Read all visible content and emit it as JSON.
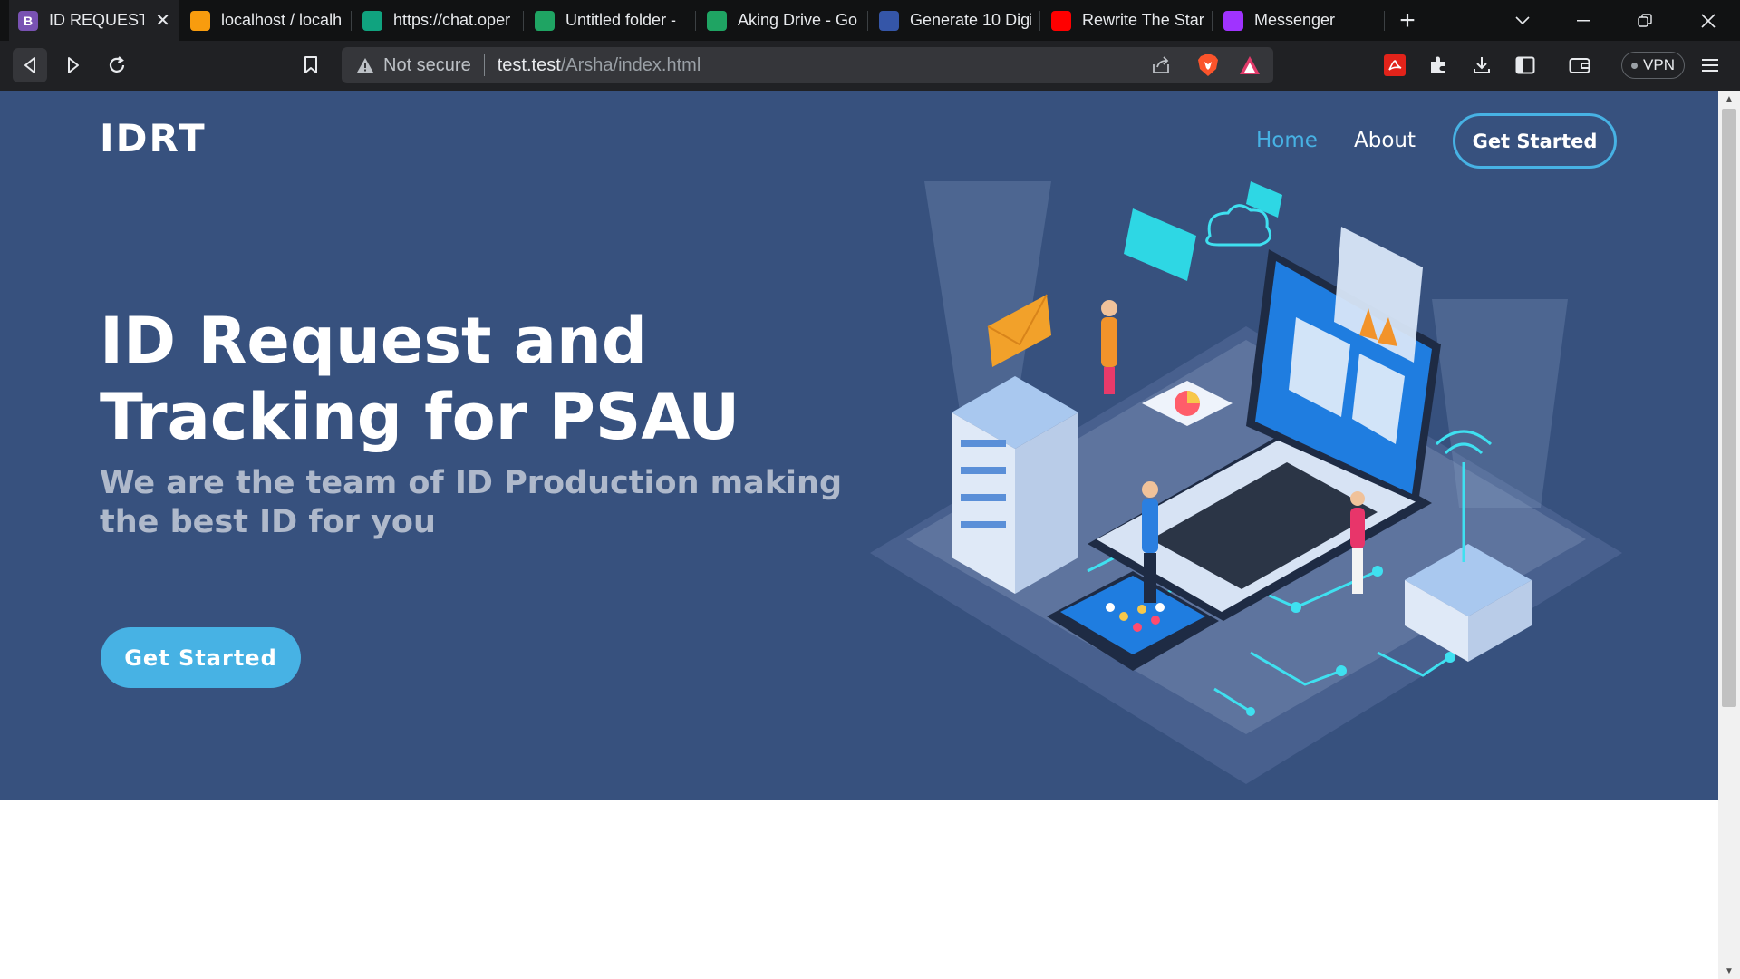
{
  "browser": {
    "tabs": [
      {
        "title": "ID REQUEST",
        "favicon": "B",
        "favicon_color": "#7952b3",
        "active": true
      },
      {
        "title": "localhost / localh",
        "favicon": "pma",
        "favicon_color": "#f89c0e"
      },
      {
        "title": "https://chat.oper",
        "favicon": "gpt",
        "favicon_color": "#10a37f"
      },
      {
        "title": "Untitled folder -",
        "favicon": "drive",
        "favicon_color": "#1fa463"
      },
      {
        "title": "Aking Drive - Go",
        "favicon": "drive",
        "favicon_color": "#1fa463"
      },
      {
        "title": "Generate 10 Digi",
        "favicon": "gen",
        "favicon_color": "#3556a8"
      },
      {
        "title": "Rewrite The Stars",
        "favicon": "yt",
        "favicon_color": "#ff0000"
      },
      {
        "title": "Messenger",
        "favicon": "msg",
        "favicon_color": "#a033ff"
      }
    ],
    "address": {
      "security_label": "Not secure",
      "host": "test.test",
      "path": "/Arsha/index.html"
    },
    "vpn_label": "VPN"
  },
  "site": {
    "logo": "IDRT",
    "nav": {
      "home": "Home",
      "about": "About",
      "cta": "Get Started"
    },
    "hero": {
      "title": "ID Request and Tracking for PSAU",
      "subtitle": "We are the team of ID Production making the best ID for you",
      "cta": "Get Started"
    },
    "colors": {
      "hero_bg": "#37517e",
      "accent": "#47b2e4"
    }
  }
}
